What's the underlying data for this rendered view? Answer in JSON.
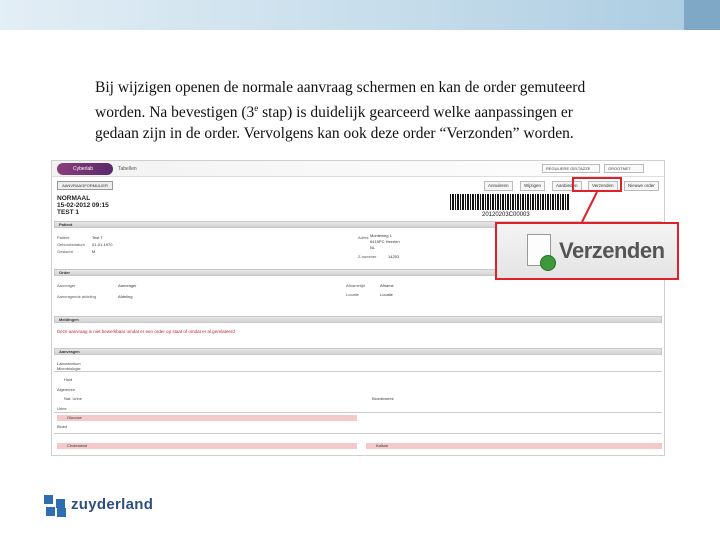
{
  "caption": {
    "line1": "Bij wijzigen openen de normale aanvraag schermen en kan de order gemuteerd",
    "line2a": "worden. Na bevestigen  (3",
    "line2sup": "e",
    "line2b": " stap) is duidelijk gearceerd welke aanpassingen er",
    "line3": "gedaan zijn in de order. Vervolgens kan ook deze order “Verzonden” worden."
  },
  "screenshot": {
    "header_logo": "Cyberlab",
    "header_link": "Tabellen",
    "header_select1": "REGULIERE GELTAZZE",
    "header_select2": "GROOTNET",
    "gear_button": "AANVRAAGFORMULIER",
    "toolbar": [
      "Annuleren",
      "Wijzigen",
      "Aanbieden",
      "Verzenden",
      "Nieuwe order"
    ],
    "order_type": "NORMAAL",
    "order_date": "15-02-2012 09:15",
    "order_name": "TEST 1",
    "barcode_number": "20120203C00003",
    "sections": [
      "Patient",
      "Order",
      "Meldingen",
      "Aanvragen"
    ],
    "patient_fields": [
      "Patient",
      "Geboortedatum",
      "Geslacht"
    ],
    "patient_values": [
      "Test T",
      "01-01-1970",
      "M"
    ],
    "patient_fields_right": [
      "Adres",
      "",
      "Z-nummer"
    ],
    "patient_values_right": [
      "Monteweg 1",
      "6419PC Heerlen",
      "NL",
      "14253"
    ],
    "order_fields": [
      "Aanvrager",
      "Aanvragende afdeling"
    ],
    "order_values": [
      "Aanvrager",
      "Afdeling"
    ],
    "order_fields_right": [
      "Afnametijd",
      "Locatie"
    ],
    "order_values_right": [
      "Afname",
      "Locatie"
    ],
    "warning": "Deze aanvraag is niet bewerkbaar omdat er een order op staat of omdat er al gerelateerd",
    "sub_labels": [
      "Laboratorium",
      "Microbiologie",
      "Algemeen",
      "Urine",
      "Bloed"
    ],
    "rows": [
      "Huid",
      "Nat. Urine",
      "Bloedkweek",
      "Glucose",
      "Cholesterol",
      "Kalium"
    ]
  },
  "zoom_label": "Verzenden",
  "brand": {
    "name": "zuyderland",
    "color": "#2f6db3"
  },
  "accent_red": "#e0202a"
}
